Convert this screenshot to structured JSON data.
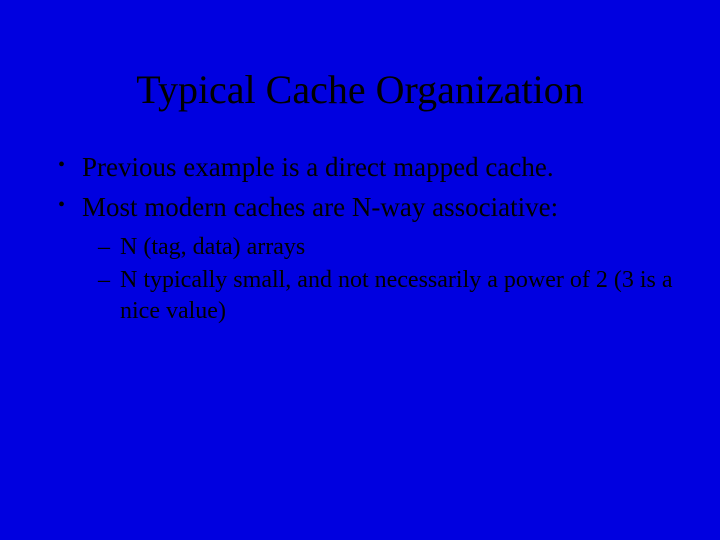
{
  "slide": {
    "title": "Typical Cache Organization",
    "bullets": [
      {
        "level": 1,
        "marker": "•",
        "text": "Previous example is a direct mapped cache."
      },
      {
        "level": 1,
        "marker": "•",
        "text": "Most modern caches are N-way associative:"
      },
      {
        "level": 2,
        "marker": "–",
        "text": "N (tag, data) arrays"
      },
      {
        "level": 2,
        "marker": "–",
        "text": "N typically small, and not necessarily a power of 2 (3 is a nice value)"
      }
    ]
  }
}
